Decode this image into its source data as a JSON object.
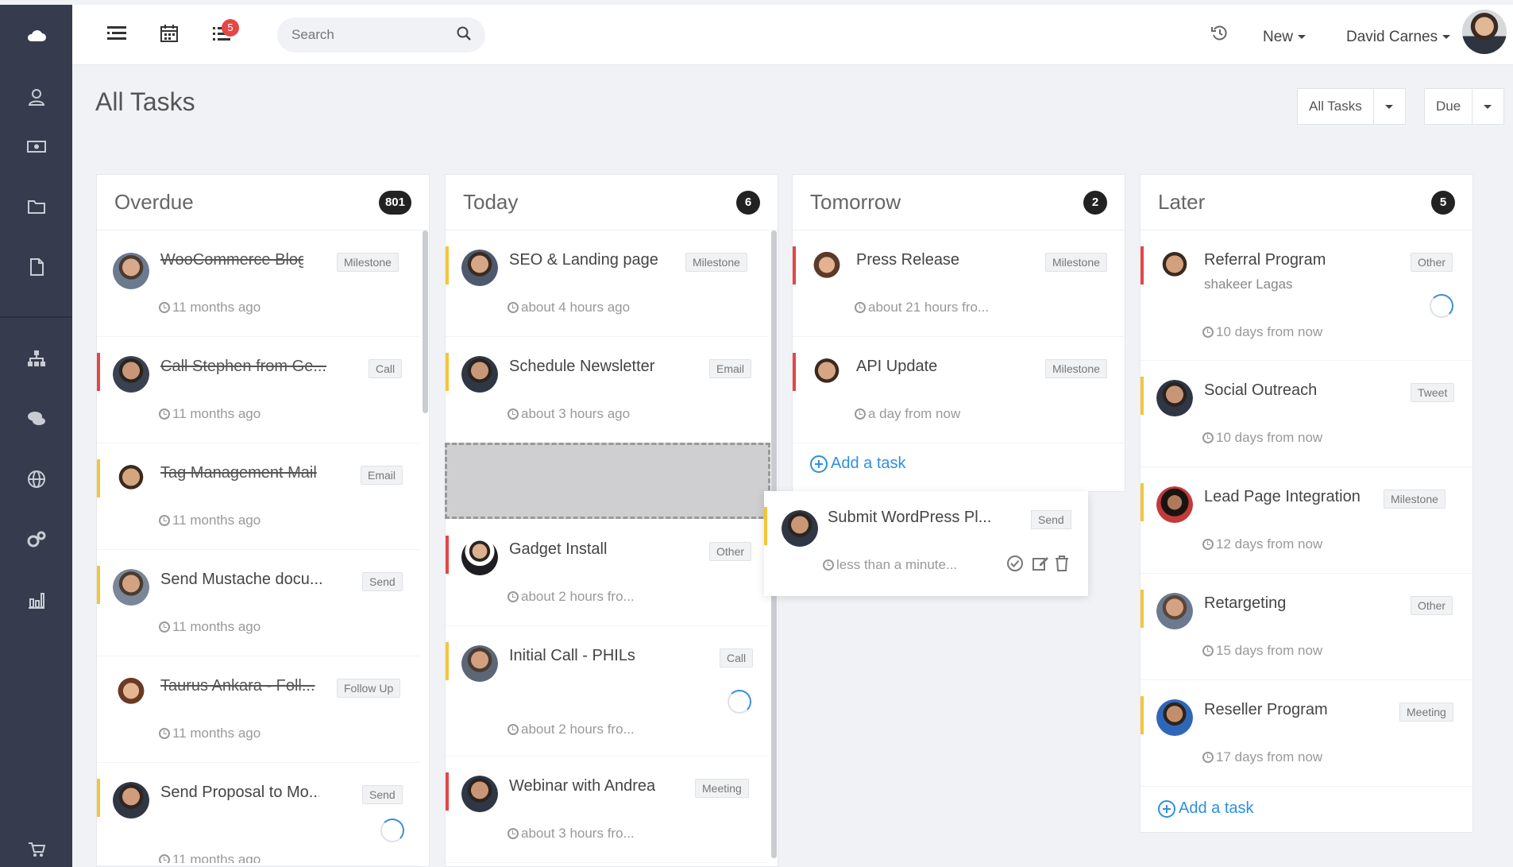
{
  "sidebar": {
    "items": [
      {
        "icon": "cloud-icon"
      },
      {
        "icon": "user-icon"
      },
      {
        "icon": "money-icon"
      },
      {
        "icon": "folder-icon"
      },
      {
        "icon": "document-icon"
      },
      {
        "icon": "org-chart-icon"
      },
      {
        "icon": "chat-icon"
      },
      {
        "icon": "globe-icon"
      },
      {
        "icon": "settings-gears-icon"
      },
      {
        "icon": "bar-chart-icon"
      },
      {
        "icon": "cart-icon"
      }
    ],
    "bg_color": "#363c4d"
  },
  "topbar": {
    "notification_count": "5",
    "search_placeholder": "Search",
    "new_label": "New",
    "user_name": "David Carnes"
  },
  "page": {
    "title": "All Tasks",
    "filter_label": "All Tasks",
    "sort_label": "Due"
  },
  "columns": [
    {
      "title": "Overdue",
      "count": "801",
      "cards": [
        {
          "title": "WooCommerce Blog",
          "tag": "Milestone",
          "time": "11 months ago",
          "done": true,
          "bar": ""
        },
        {
          "title": "Call Stephen from Ge...",
          "tag": "Call",
          "time": "11 months ago",
          "done": true,
          "bar": "#e54646"
        },
        {
          "title": "Tag Management Mail",
          "tag": "Email",
          "time": "11 months ago",
          "done": true,
          "bar": "#f3c53a"
        },
        {
          "title": "Send Mustache docu...",
          "tag": "Send",
          "time": "11 months ago",
          "done": false,
          "bar": "#f3c53a"
        },
        {
          "title": "Taurus Ankara - Foll...",
          "tag": "Follow Up",
          "time": "11 months ago",
          "done": true,
          "bar": ""
        },
        {
          "title": "Send Proposal to Mo...",
          "tag": "Send",
          "time": "11 months ago",
          "done": false,
          "bar": "#f3c53a"
        }
      ]
    },
    {
      "title": "Today",
      "count": "6",
      "cards": [
        {
          "title": "SEO & Landing page",
          "tag": "Milestone",
          "time": "about 4 hours ago",
          "bar": "#f3c53a"
        },
        {
          "title": "Schedule Newsletter",
          "tag": "Email",
          "time": "about 3 hours ago",
          "bar": "#f3c53a"
        },
        {
          "title": "Gadget Install",
          "tag": "Other",
          "time": "about 2 hours fro...",
          "bar": "#e54646"
        },
        {
          "title": "Initial Call - PHILs",
          "tag": "Call",
          "time": "about 2 hours fro...",
          "bar": "#f3c53a"
        },
        {
          "title": "Webinar with Andrea",
          "tag": "Meeting",
          "time": "about 3 hours fro...",
          "bar": "#e54646"
        }
      ]
    },
    {
      "title": "Tomorrow",
      "count": "2",
      "cards": [
        {
          "title": "Press Release",
          "tag": "Milestone",
          "time": "about 21 hours fro...",
          "bar": "#e54646"
        },
        {
          "title": "API Update",
          "tag": "Milestone",
          "time": "a day from now",
          "bar": "#e54646"
        }
      ],
      "add_label": "Add a task"
    },
    {
      "title": "Later",
      "count": "5",
      "cards": [
        {
          "title": "Referral Program",
          "subtitle": "shakeer Lagas",
          "tag": "Other",
          "time": "10 days from now",
          "bar": "#e54646"
        },
        {
          "title": "Social Outreach",
          "tag": "Tweet",
          "time": "10 days from now",
          "bar": "#f3c53a"
        },
        {
          "title": "Lead Page Integration",
          "tag": "Milestone",
          "time": "12 days from now",
          "bar": "#f3c53a"
        },
        {
          "title": "Retargeting",
          "tag": "Other",
          "time": "15 days from now",
          "bar": "#f3c53a"
        },
        {
          "title": "Reseller Program",
          "tag": "Meeting",
          "time": "17 days from now",
          "bar": "#f3c53a"
        }
      ],
      "add_label": "Add a task"
    }
  ],
  "dragging_card": {
    "title": "Submit WordPress Pl...",
    "tag": "Send",
    "time": "less than a minute...",
    "bar": "#f3c53a"
  },
  "colors": {
    "accent": "#2e8fe0",
    "overdue_bar": "#e54646",
    "warn_bar": "#f3c53a"
  }
}
